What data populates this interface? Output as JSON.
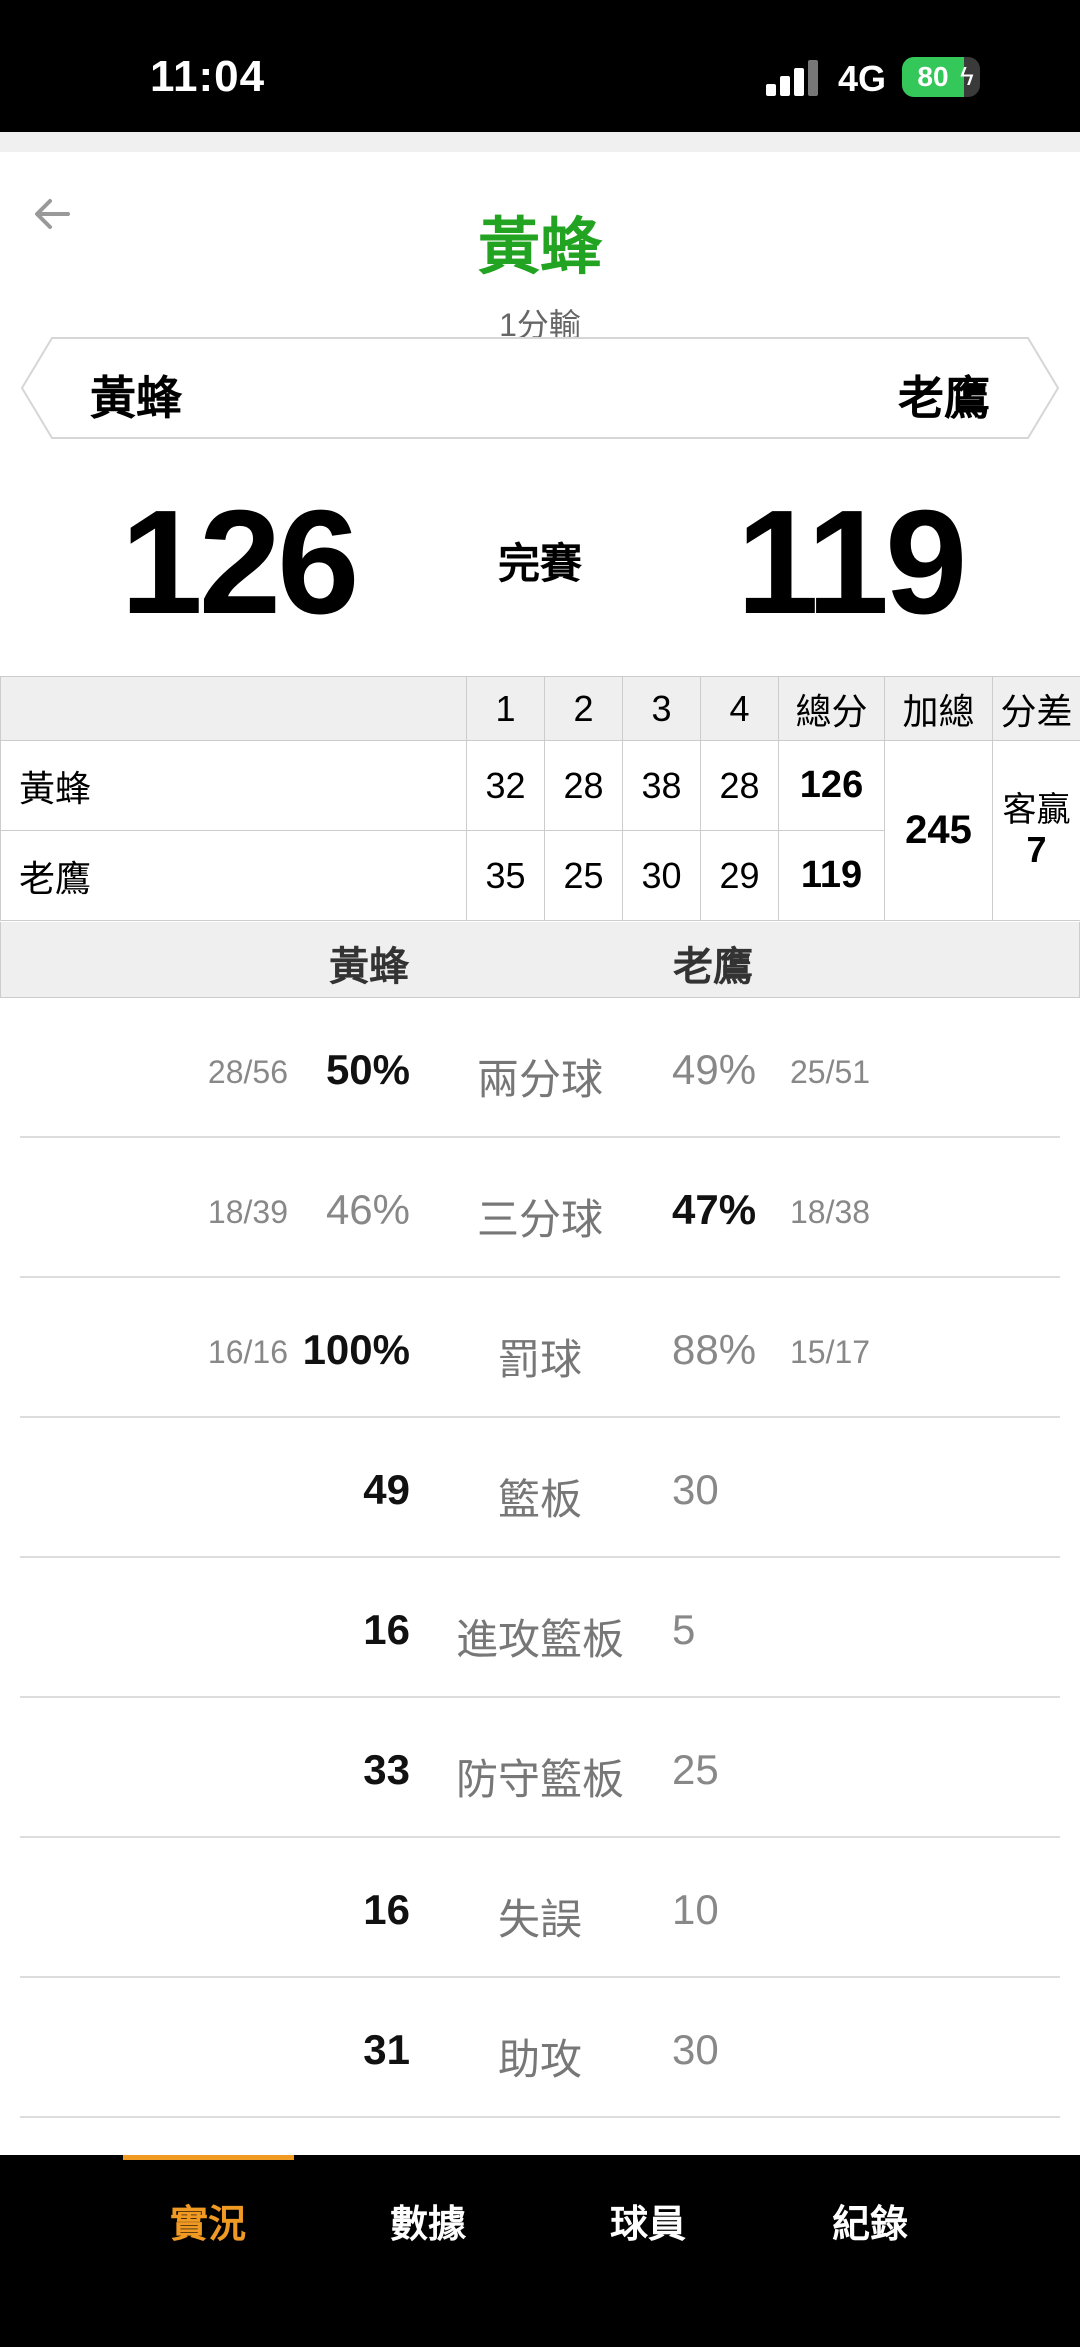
{
  "status_bar": {
    "time": "11:04",
    "network": "4G",
    "battery": "80",
    "battery_level": 0.8
  },
  "header": {
    "title": "黃蜂",
    "result": "1分輸",
    "home_team": "黃蜂",
    "away_team": "老鷹",
    "home_score": "126",
    "away_score": "119",
    "status": "完賽"
  },
  "quarter_table": {
    "headers": [
      "",
      "1",
      "2",
      "3",
      "4",
      "總分",
      "加總",
      "分差"
    ],
    "rows": [
      {
        "team": "黃蜂",
        "q": [
          "32",
          "28",
          "38",
          "28"
        ],
        "total": "126"
      },
      {
        "team": "老鷹",
        "q": [
          "35",
          "25",
          "30",
          "29"
        ],
        "total": "119"
      }
    ],
    "combined": "245",
    "diff_label": "客贏",
    "diff_value": "7"
  },
  "compare_header": {
    "home": "黃蜂",
    "away": "老鷹"
  },
  "stats": [
    {
      "label": "兩分球",
      "home_frac": "28/56",
      "home": "50%",
      "away": "49%",
      "away_frac": "25/51"
    },
    {
      "label": "三分球",
      "home_frac": "18/39",
      "home": "46%",
      "away": "47%",
      "away_frac": "18/38"
    },
    {
      "label": "罰球",
      "home_frac": "16/16",
      "home": "100%",
      "away": "88%",
      "away_frac": "15/17"
    },
    {
      "label": "籃板",
      "home": "49",
      "away": "30"
    },
    {
      "label": "進攻籃板",
      "home": "16",
      "away": "5"
    },
    {
      "label": "防守籃板",
      "home": "33",
      "away": "25"
    },
    {
      "label": "失誤",
      "home": "16",
      "away": "10"
    },
    {
      "label": "助攻",
      "home": "31",
      "away": "30"
    }
  ],
  "bottom_nav": [
    {
      "label": "實況",
      "active": true
    },
    {
      "label": "數據",
      "active": false
    },
    {
      "label": "球員",
      "active": false
    },
    {
      "label": "紀錄",
      "active": false
    }
  ],
  "colors": {
    "title_green": "#22a322",
    "accent_orange": "#f09a24"
  }
}
